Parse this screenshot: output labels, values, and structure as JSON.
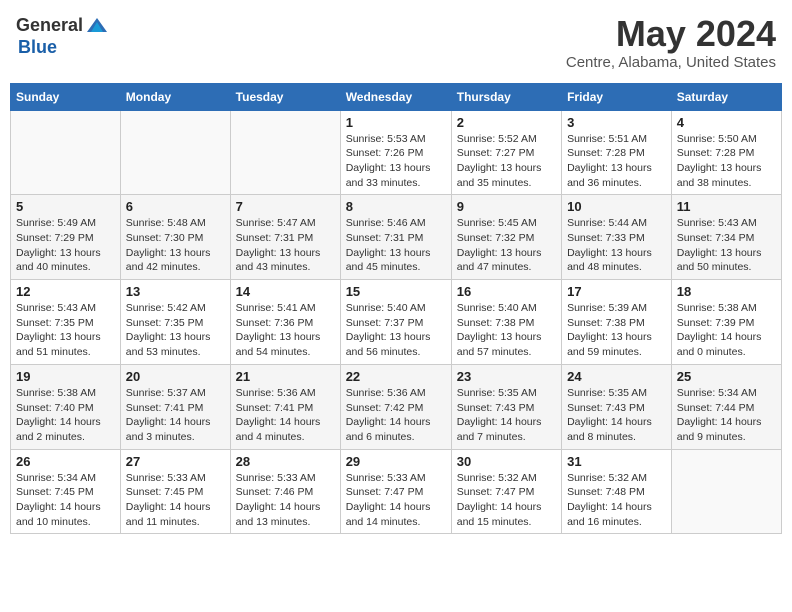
{
  "header": {
    "logo": {
      "text_general": "General",
      "text_blue": "Blue"
    },
    "month": "May 2024",
    "location": "Centre, Alabama, United States"
  },
  "weekdays": [
    "Sunday",
    "Monday",
    "Tuesday",
    "Wednesday",
    "Thursday",
    "Friday",
    "Saturday"
  ],
  "rows": [
    [
      {
        "day": "",
        "info": ""
      },
      {
        "day": "",
        "info": ""
      },
      {
        "day": "",
        "info": ""
      },
      {
        "day": "1",
        "info": "Sunrise: 5:53 AM\nSunset: 7:26 PM\nDaylight: 13 hours\nand 33 minutes."
      },
      {
        "day": "2",
        "info": "Sunrise: 5:52 AM\nSunset: 7:27 PM\nDaylight: 13 hours\nand 35 minutes."
      },
      {
        "day": "3",
        "info": "Sunrise: 5:51 AM\nSunset: 7:28 PM\nDaylight: 13 hours\nand 36 minutes."
      },
      {
        "day": "4",
        "info": "Sunrise: 5:50 AM\nSunset: 7:28 PM\nDaylight: 13 hours\nand 38 minutes."
      }
    ],
    [
      {
        "day": "5",
        "info": "Sunrise: 5:49 AM\nSunset: 7:29 PM\nDaylight: 13 hours\nand 40 minutes."
      },
      {
        "day": "6",
        "info": "Sunrise: 5:48 AM\nSunset: 7:30 PM\nDaylight: 13 hours\nand 42 minutes."
      },
      {
        "day": "7",
        "info": "Sunrise: 5:47 AM\nSunset: 7:31 PM\nDaylight: 13 hours\nand 43 minutes."
      },
      {
        "day": "8",
        "info": "Sunrise: 5:46 AM\nSunset: 7:31 PM\nDaylight: 13 hours\nand 45 minutes."
      },
      {
        "day": "9",
        "info": "Sunrise: 5:45 AM\nSunset: 7:32 PM\nDaylight: 13 hours\nand 47 minutes."
      },
      {
        "day": "10",
        "info": "Sunrise: 5:44 AM\nSunset: 7:33 PM\nDaylight: 13 hours\nand 48 minutes."
      },
      {
        "day": "11",
        "info": "Sunrise: 5:43 AM\nSunset: 7:34 PM\nDaylight: 13 hours\nand 50 minutes."
      }
    ],
    [
      {
        "day": "12",
        "info": "Sunrise: 5:43 AM\nSunset: 7:35 PM\nDaylight: 13 hours\nand 51 minutes."
      },
      {
        "day": "13",
        "info": "Sunrise: 5:42 AM\nSunset: 7:35 PM\nDaylight: 13 hours\nand 53 minutes."
      },
      {
        "day": "14",
        "info": "Sunrise: 5:41 AM\nSunset: 7:36 PM\nDaylight: 13 hours\nand 54 minutes."
      },
      {
        "day": "15",
        "info": "Sunrise: 5:40 AM\nSunset: 7:37 PM\nDaylight: 13 hours\nand 56 minutes."
      },
      {
        "day": "16",
        "info": "Sunrise: 5:40 AM\nSunset: 7:38 PM\nDaylight: 13 hours\nand 57 minutes."
      },
      {
        "day": "17",
        "info": "Sunrise: 5:39 AM\nSunset: 7:38 PM\nDaylight: 13 hours\nand 59 minutes."
      },
      {
        "day": "18",
        "info": "Sunrise: 5:38 AM\nSunset: 7:39 PM\nDaylight: 14 hours\nand 0 minutes."
      }
    ],
    [
      {
        "day": "19",
        "info": "Sunrise: 5:38 AM\nSunset: 7:40 PM\nDaylight: 14 hours\nand 2 minutes."
      },
      {
        "day": "20",
        "info": "Sunrise: 5:37 AM\nSunset: 7:41 PM\nDaylight: 14 hours\nand 3 minutes."
      },
      {
        "day": "21",
        "info": "Sunrise: 5:36 AM\nSunset: 7:41 PM\nDaylight: 14 hours\nand 4 minutes."
      },
      {
        "day": "22",
        "info": "Sunrise: 5:36 AM\nSunset: 7:42 PM\nDaylight: 14 hours\nand 6 minutes."
      },
      {
        "day": "23",
        "info": "Sunrise: 5:35 AM\nSunset: 7:43 PM\nDaylight: 14 hours\nand 7 minutes."
      },
      {
        "day": "24",
        "info": "Sunrise: 5:35 AM\nSunset: 7:43 PM\nDaylight: 14 hours\nand 8 minutes."
      },
      {
        "day": "25",
        "info": "Sunrise: 5:34 AM\nSunset: 7:44 PM\nDaylight: 14 hours\nand 9 minutes."
      }
    ],
    [
      {
        "day": "26",
        "info": "Sunrise: 5:34 AM\nSunset: 7:45 PM\nDaylight: 14 hours\nand 10 minutes."
      },
      {
        "day": "27",
        "info": "Sunrise: 5:33 AM\nSunset: 7:45 PM\nDaylight: 14 hours\nand 11 minutes."
      },
      {
        "day": "28",
        "info": "Sunrise: 5:33 AM\nSunset: 7:46 PM\nDaylight: 14 hours\nand 13 minutes."
      },
      {
        "day": "29",
        "info": "Sunrise: 5:33 AM\nSunset: 7:47 PM\nDaylight: 14 hours\nand 14 minutes."
      },
      {
        "day": "30",
        "info": "Sunrise: 5:32 AM\nSunset: 7:47 PM\nDaylight: 14 hours\nand 15 minutes."
      },
      {
        "day": "31",
        "info": "Sunrise: 5:32 AM\nSunset: 7:48 PM\nDaylight: 14 hours\nand 16 minutes."
      },
      {
        "day": "",
        "info": ""
      }
    ]
  ]
}
